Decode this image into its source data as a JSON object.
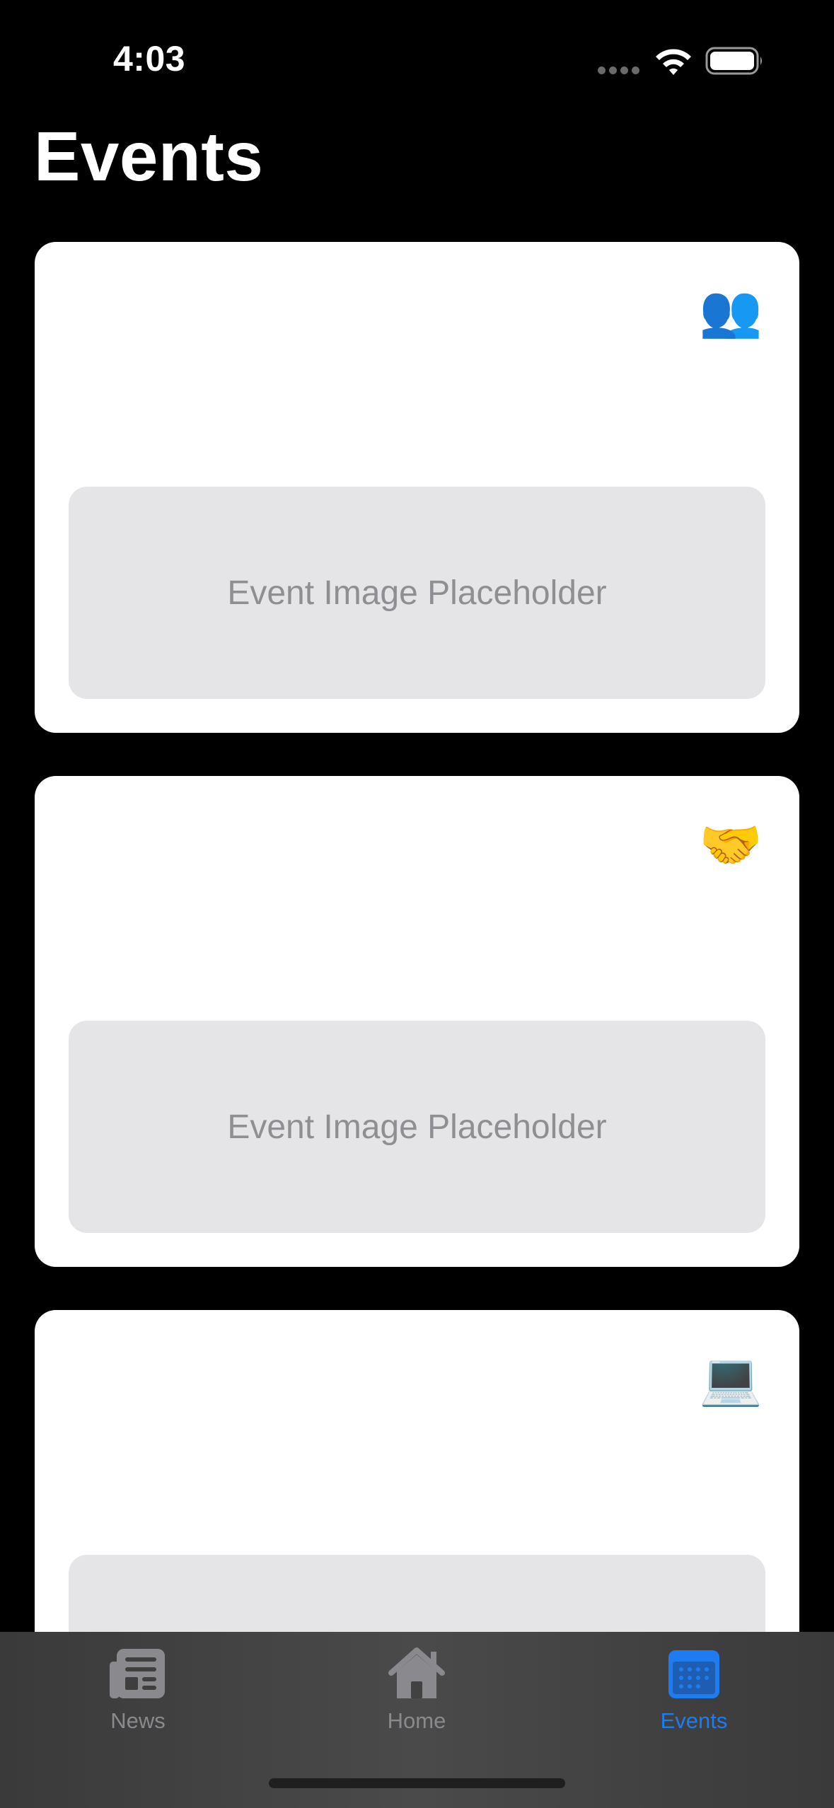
{
  "status_bar": {
    "time": "4:03"
  },
  "header": {
    "title": "Events"
  },
  "events": [
    {
      "emoji": "👥",
      "icon_name": "people-icon",
      "image_placeholder": "Event Image Placeholder"
    },
    {
      "emoji": "🤝",
      "icon_name": "handshake-icon",
      "image_placeholder": "Event Image Placeholder"
    },
    {
      "emoji": "💻",
      "icon_name": "laptop-icon",
      "image_placeholder": ""
    }
  ],
  "tab_bar": {
    "items": [
      {
        "label": "News",
        "icon": "newspaper-icon",
        "active": false
      },
      {
        "label": "Home",
        "icon": "house-icon",
        "active": false
      },
      {
        "label": "Events",
        "icon": "calendar-icon",
        "active": true
      }
    ]
  },
  "colors": {
    "background": "#000000",
    "card": "#ffffff",
    "placeholder": "#e5e5e7",
    "accent": "#1e7cf0",
    "inactive_tab": "#8a8a8e"
  }
}
